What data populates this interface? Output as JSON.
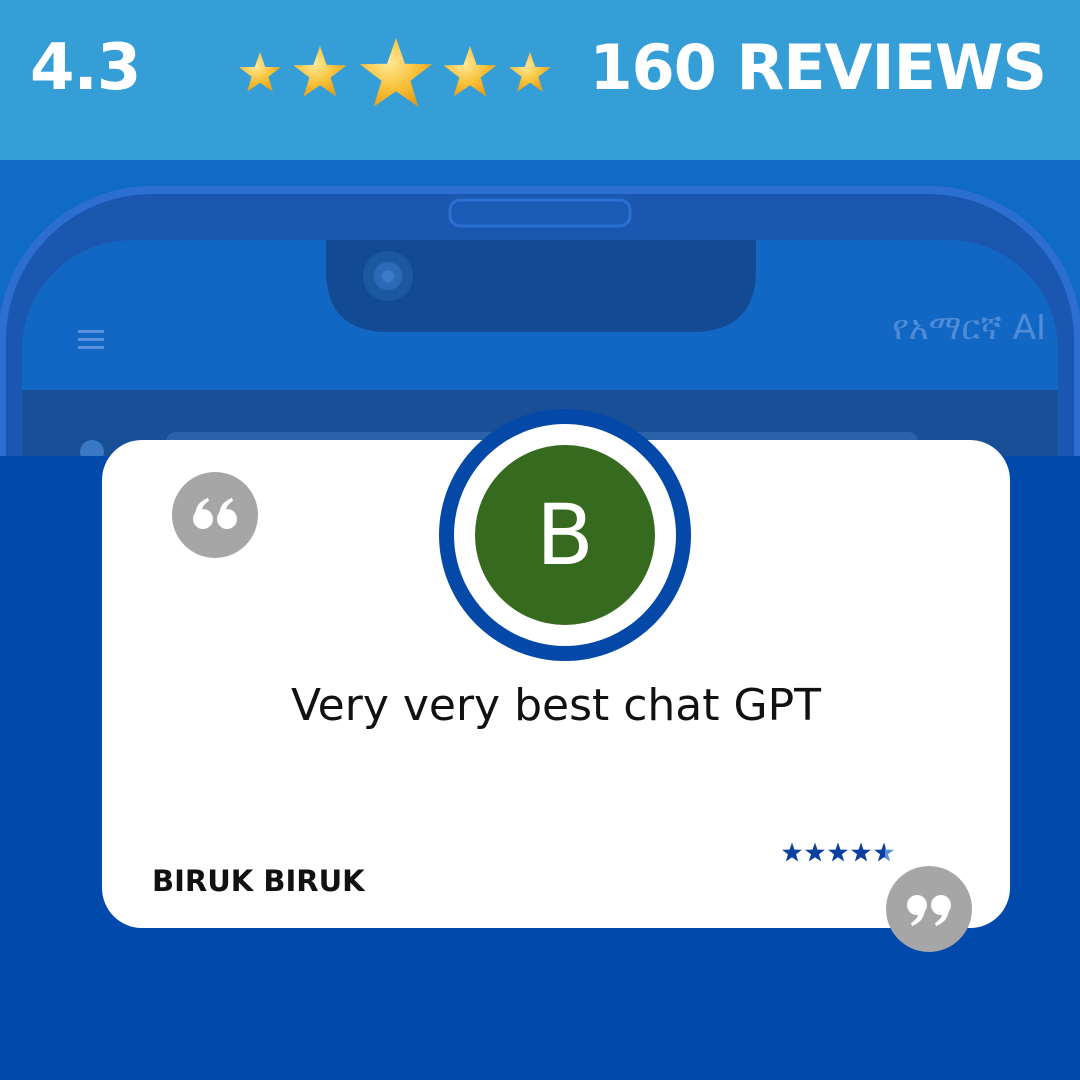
{
  "header": {
    "rating": "4.3",
    "rating_value": 4.3,
    "rating_max": 5,
    "reviews_label": "160 REVIEWS"
  },
  "phone": {
    "app_title": "የአማርኛ AI",
    "menu_icon": "hamburger-menu-icon",
    "camera_icon": "camera-lens-icon"
  },
  "review": {
    "avatar_initial": "B",
    "text": "Very very best chat GPT",
    "reviewer_name": "BIRUK BIRUK",
    "stars": 4.5,
    "stars_max": 5
  },
  "icons": {
    "open_quote": "open-quote-icon",
    "close_quote": "close-quote-icon",
    "star": "star-icon"
  },
  "colors": {
    "top_bar": "#359ed7",
    "background": "#014aac",
    "avatar": "#366a1f",
    "star_gold": "#f8c23a",
    "small_star": "#0b3fa0"
  }
}
